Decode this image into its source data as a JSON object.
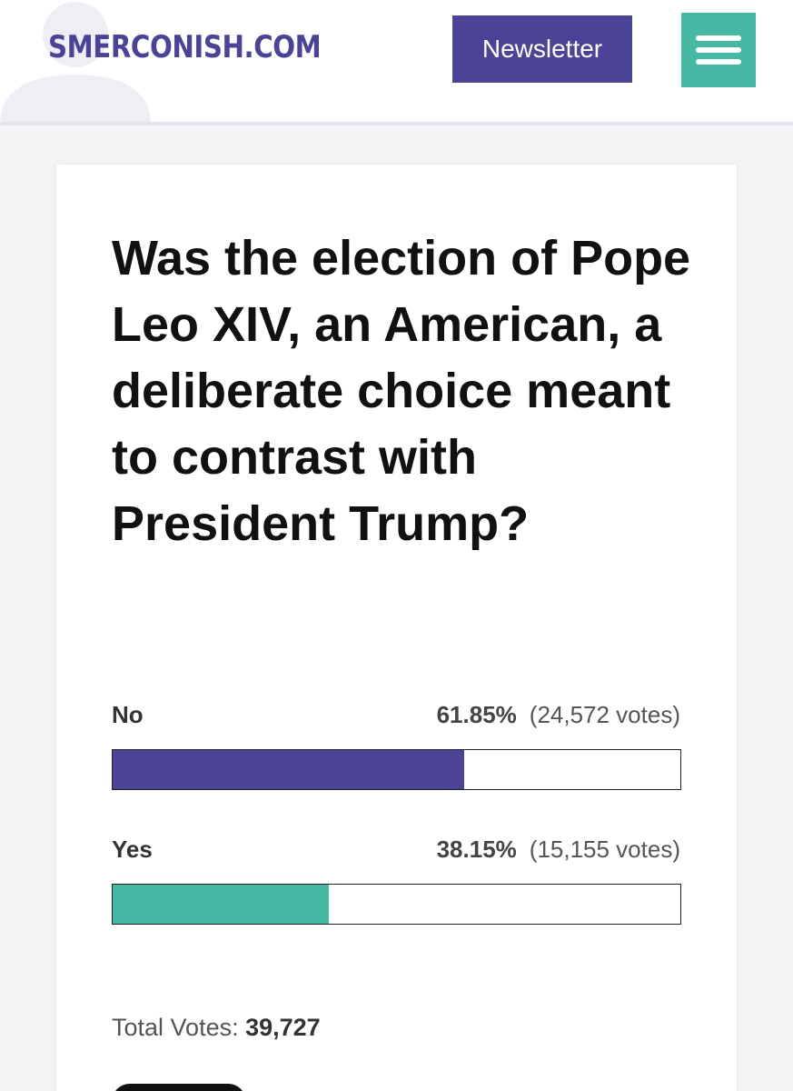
{
  "header": {
    "logo": "SMERCONISH.COM",
    "newsletter_label": "Newsletter",
    "menu_icon": "hamburger-menu-icon",
    "colors": {
      "brand_purple": "#4a4396",
      "brand_teal": "#47b8a4"
    }
  },
  "poll": {
    "question": "Was the election of Pope Leo XIV, an American, a deliberate choice meant to contrast with President Trump?",
    "options": [
      {
        "label": "No",
        "percent_text": "61.85%",
        "votes_text": "(24,572 votes)",
        "percent": 61.85,
        "color": "#4a4396"
      },
      {
        "label": "Yes",
        "percent_text": "38.15%",
        "votes_text": "(15,155 votes)",
        "percent": 38.15,
        "color": "#47b8a4"
      }
    ],
    "total_label": "Total Votes:",
    "total_value": "39,727"
  }
}
